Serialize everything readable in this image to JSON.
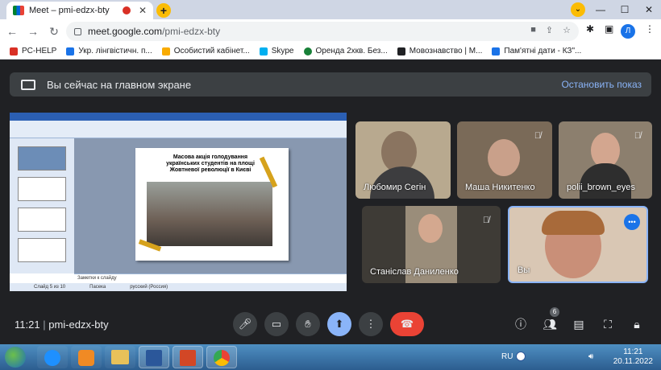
{
  "browser": {
    "tab_title": "Meet – pmi-edzx-bty",
    "tab_close": "✕",
    "new_tab": "+",
    "url_host": "meet.google.com",
    "url_path": "/pmi-edzx-bty",
    "profile_initial": "Л",
    "window_controls": [
      "⌄",
      "—",
      "☐",
      "✕"
    ]
  },
  "bookmarks": [
    {
      "label": "PC-HELP",
      "color": "#d93025"
    },
    {
      "label": "Укр. лінгвістичн. п...",
      "color": "#1a73e8"
    },
    {
      "label": "Особистий кабінет...",
      "color": "#f9ab00"
    },
    {
      "label": "Skype",
      "color": "#00aff0"
    },
    {
      "label": "Оренда 2хкв. Без...",
      "color": "#188038"
    },
    {
      "label": "Мовознавство | М...",
      "color": "#202124"
    },
    {
      "label": "Пам'ятні дати - КЗ\"...",
      "color": "#1a73e8"
    }
  ],
  "meet": {
    "banner_text": "Вы сейчас на главном экране",
    "stop_label": "Остановить показ",
    "slide_title": "Масова акція голодування українських студентів на площі Жовтневої революції в Києві",
    "slide_notes": "Заметки к слайду",
    "slide_status": [
      "Слайд 5 из 10",
      "Пасека",
      "русский (Россия)"
    ],
    "participants": [
      {
        "name": "Любомир Сегін",
        "muted": false,
        "bg": "#b8a98f"
      },
      {
        "name": "Маша Никитенко",
        "muted": true,
        "bg": "#7a6a58"
      },
      {
        "name": "polii_brown_eyes",
        "muted": true,
        "bg": "#8c7f6e"
      },
      {
        "name": "Станіслав Даниленко",
        "muted": true,
        "bg": "#3e3b36"
      },
      {
        "name": "Вы",
        "muted": false,
        "bg": "#d9c7b4"
      }
    ],
    "meeting_time": "11:21",
    "separator": "|",
    "meeting_code": "pmi-edzx-bty",
    "participant_count": "6",
    "more": "•••"
  },
  "taskbar": {
    "lang": "RU",
    "time": "11:21",
    "date": "20.11.2022"
  }
}
